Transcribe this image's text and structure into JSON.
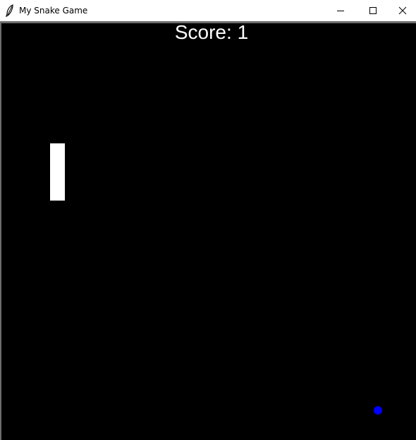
{
  "window": {
    "title": "My Snake Game",
    "icon": "feather-icon",
    "controls": [
      "minimize-icon",
      "maximize-icon",
      "close-icon"
    ]
  },
  "game": {
    "score_text": "Score: 1",
    "background_color": "#000000",
    "snake_color": "#ffffff",
    "food_color": "#0000ff"
  }
}
